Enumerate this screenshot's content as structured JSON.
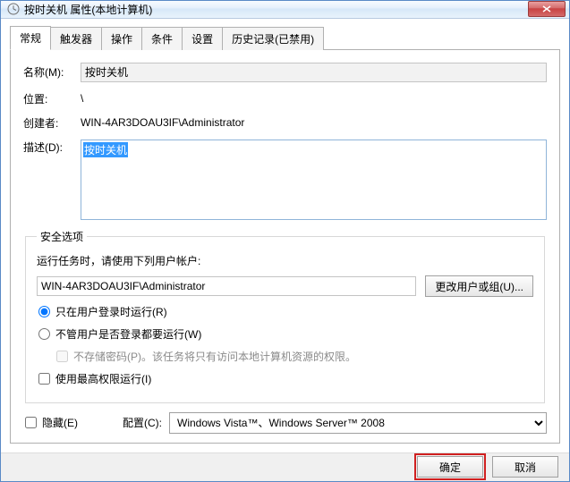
{
  "window": {
    "title": "按时关机 属性(本地计算机)"
  },
  "tabs": {
    "general": "常规",
    "trigger": "触发器",
    "action": "操作",
    "condition": "条件",
    "setting": "设置",
    "history": "历史记录(已禁用)"
  },
  "general": {
    "name_label": "名称(M):",
    "name_value": "按时关机",
    "location_label": "位置:",
    "location_value": "\\",
    "creator_label": "创建者:",
    "creator_value": "WIN-4AR3DOAU3IF\\Administrator",
    "desc_label": "描述(D):",
    "desc_value": "按时关机"
  },
  "security": {
    "legend": "安全选项",
    "run_as_label": "运行任务时，请使用下列用户帐户:",
    "account": "WIN-4AR3DOAU3IF\\Administrator",
    "change_user_btn": "更改用户或组(U)...",
    "radio_logged_on": "只在用户登录时运行(R)",
    "radio_any": "不管用户是否登录都要运行(W)",
    "no_password": "不存储密码(P)。该任务将只有访问本地计算机资源的权限。",
    "highest_priv": "使用最高权限运行(I)"
  },
  "bottom": {
    "hidden": "隐藏(E)",
    "config_label": "配置(C):",
    "config_value": "Windows Vista™、Windows Server™ 2008"
  },
  "footer": {
    "ok": "确定",
    "cancel": "取消"
  }
}
